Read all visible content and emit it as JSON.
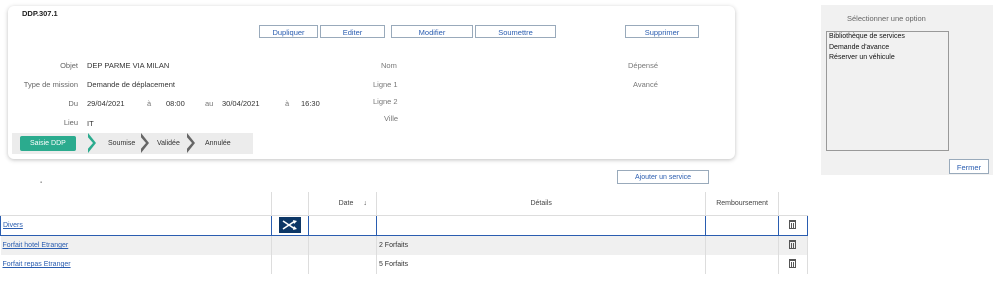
{
  "card": {
    "ref": "DDP.307.1",
    "buttons": [
      "Dupliquer",
      "Editer",
      "Modifier",
      "Soumettre",
      "Supprimer"
    ],
    "fields": {
      "objet_label": "Objet",
      "objet_value": "DEP PARME VIA MILAN",
      "type_label": "Type de mission",
      "type_value": "Demande de déplacement",
      "du_label": "Du",
      "du_date": "29/04/2021",
      "a1": "à",
      "du_time": "08:00",
      "au_label": "au",
      "au_date": "30/04/2021",
      "a2": "à",
      "au_time": "16:30",
      "lieu_label": "Lieu",
      "lieu_value": "IT"
    },
    "center_labels": [
      "Nom",
      "Ligne 1",
      "Ligne 2",
      "Ville"
    ],
    "right_labels": [
      "Dépensé",
      "Avancé"
    ],
    "status_steps": [
      "Saisie DDP",
      "Soumise",
      "Validée",
      "Annulée"
    ]
  },
  "side": {
    "title": "Sélectionner une option",
    "options": [
      "Bibliothèque de services",
      "Demande d'avance",
      "Réserver un véhicule"
    ],
    "close": "Fermer"
  },
  "add_service": "Ajouter un service",
  "table": {
    "headers": [
      "",
      "",
      "Date",
      "↓",
      "Détails",
      "Remboursement",
      ""
    ],
    "rows": [
      {
        "name": "Divers",
        "details": ""
      },
      {
        "name": "Forfait hotel Etranger",
        "details": "2 Forfaits"
      },
      {
        "name": "Forfait repas Etranger",
        "details": "5 Forfaits"
      }
    ]
  },
  "colors": {
    "accent": "#2bab8e",
    "link": "#2a5db0",
    "shuffle": "#0d3766"
  }
}
